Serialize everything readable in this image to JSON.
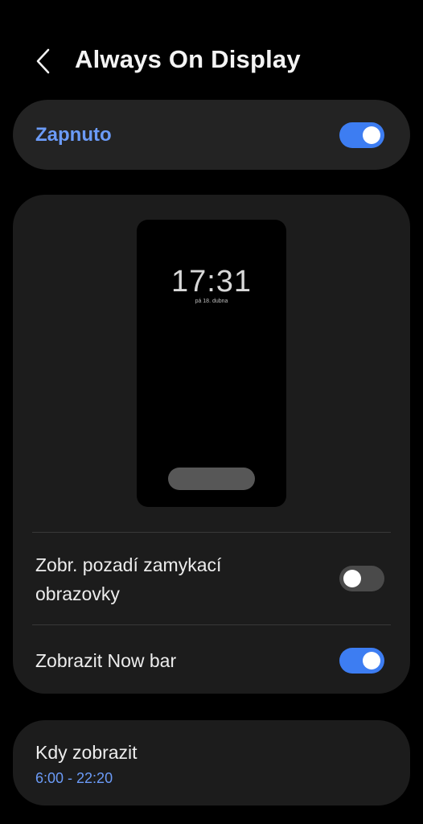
{
  "header": {
    "back_icon": "chevron-left-icon",
    "title": "Always On Display"
  },
  "master_switch": {
    "label": "Zapnuto",
    "enabled": true
  },
  "preview": {
    "time": "17:31",
    "date": "pá 18. dubna"
  },
  "options": [
    {
      "label_line1": "Zobr. pozadí zamykací",
      "label_line2": "obrazovky",
      "enabled": false
    },
    {
      "label": "Zobrazit Now bar",
      "enabled": true
    }
  ],
  "schedule": {
    "title": "Kdy zobrazit",
    "value": "6:00 - 22:20"
  },
  "colors": {
    "background": "#000000",
    "card": "#1c1c1c",
    "accent": "#3d7df2",
    "accent_text": "#6b9bf7",
    "toggle_off": "#4a4a4a"
  }
}
